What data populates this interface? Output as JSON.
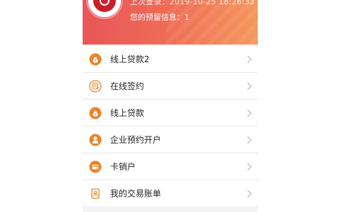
{
  "header": {
    "last_login": "上次登录：2019-10-25 18:26:33",
    "warning_info": "您的预留信息：1"
  },
  "menu": {
    "items": [
      {
        "label": "线上贷款2",
        "icon": "money-bag-icon"
      },
      {
        "label": "在线签约",
        "icon": "sign-contract-icon"
      },
      {
        "label": "线上贷款",
        "icon": "money-bag-icon"
      },
      {
        "label": "企业预约开户",
        "icon": "person-icon"
      },
      {
        "label": "卡销户",
        "icon": "card-icon"
      },
      {
        "label": "我的交易账单",
        "icon": "bill-icon"
      }
    ]
  },
  "colors": {
    "header_start": "#e9545a",
    "header_end": "#f59a5e",
    "icon_orange": "#e8842a"
  }
}
